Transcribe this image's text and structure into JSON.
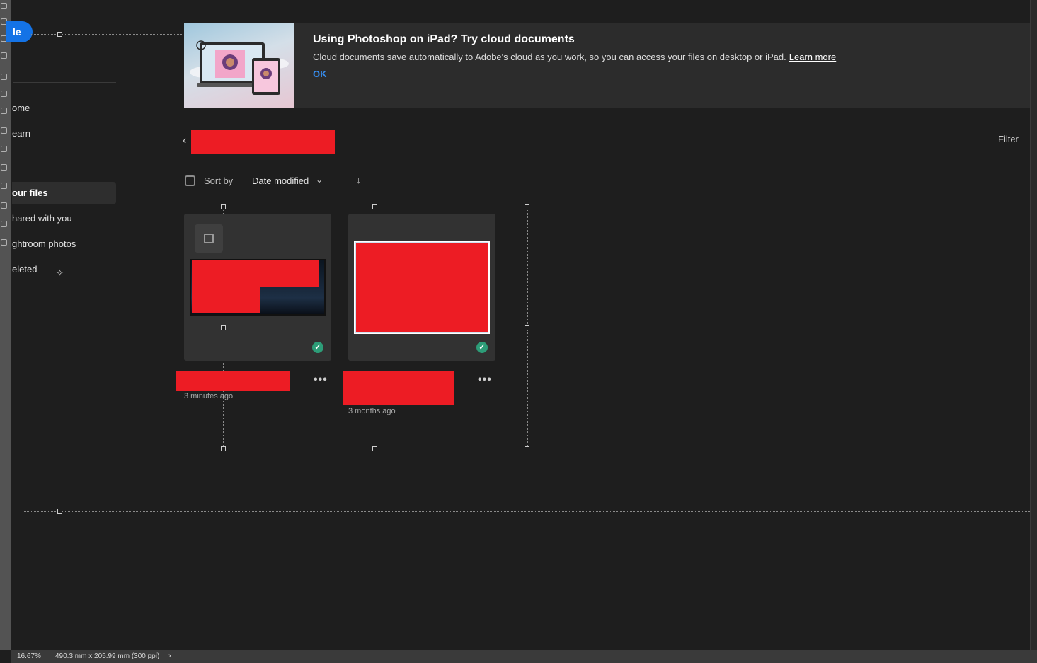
{
  "sidebar": {
    "create_label": "le",
    "items": [
      {
        "label": "ome"
      },
      {
        "label": "earn"
      },
      {
        "label": "our files"
      },
      {
        "label": "hared with you"
      },
      {
        "label": "ghtroom photos"
      },
      {
        "label": "eleted"
      }
    ],
    "active_index": 2
  },
  "banner": {
    "title": "Using Photoshop on iPad? Try cloud documents",
    "text": "Cloud documents save automatically to Adobe's cloud as you work, so you can access your files on desktop or iPad.",
    "link": "Learn more",
    "ok": "OK"
  },
  "toolbar": {
    "filter": "Filter",
    "sort_label": "Sort by",
    "sort_value": "Date modified"
  },
  "files": [
    {
      "time": "3 minutes ago",
      "synced": true
    },
    {
      "time": "3 months ago",
      "synced": true
    }
  ],
  "status": {
    "zoom": "16.67%",
    "dimensions": "490.3 mm x 205.99 mm (300 ppi)"
  },
  "colors": {
    "accent": "#1473e6",
    "link": "#378ef0",
    "redaction": "#ed1c24",
    "sync_ok": "#2d9d78"
  }
}
